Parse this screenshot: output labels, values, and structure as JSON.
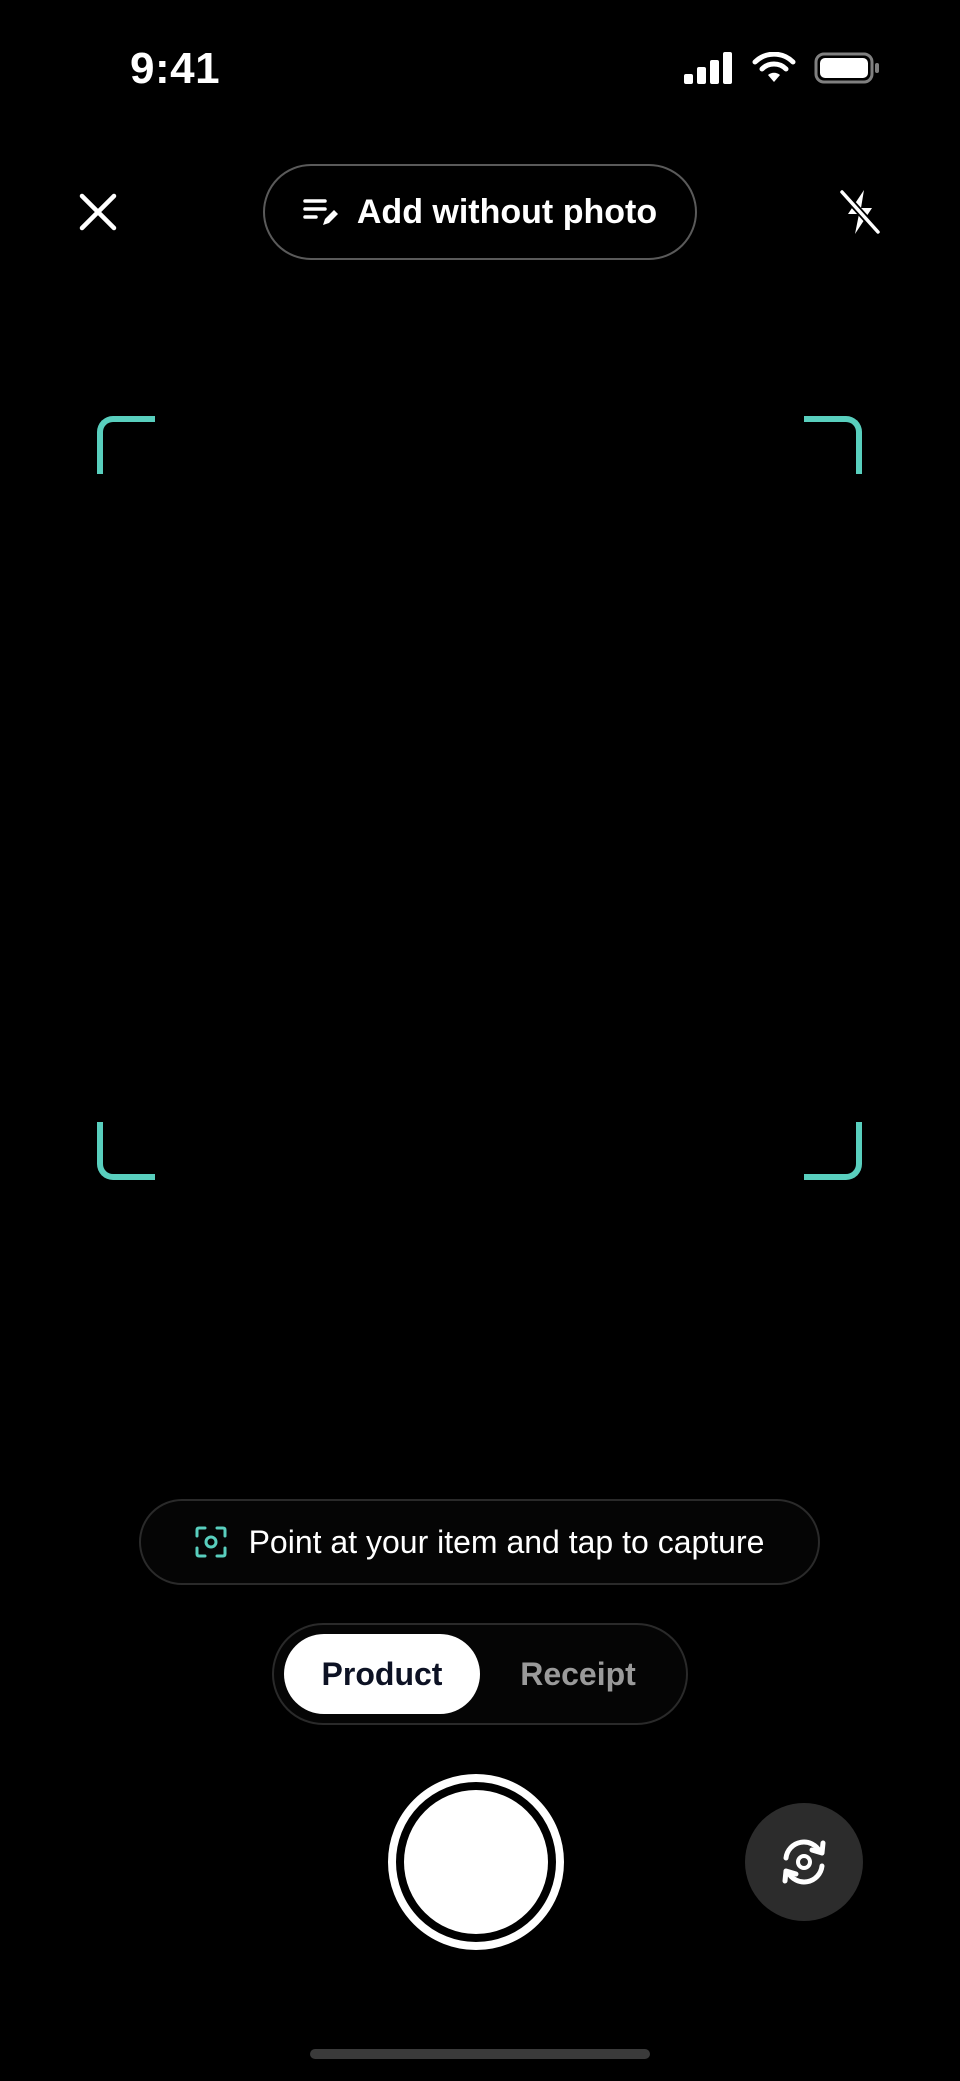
{
  "status_bar": {
    "time": "9:41",
    "icons": [
      "cellular-signal-icon",
      "wifi-icon",
      "battery-icon"
    ]
  },
  "top_bar": {
    "close_icon": "close-icon",
    "add_without_photo": {
      "icon": "edit-list-icon",
      "label": "Add without photo"
    },
    "flash_icon": "flash-off-icon"
  },
  "frame": {
    "accent_color": "#59cfbe"
  },
  "hint": {
    "icon": "focus-scan-icon",
    "text": "Point at your item and tap to capture"
  },
  "mode_toggle": {
    "options": [
      {
        "label": "Product",
        "selected": true
      },
      {
        "label": "Receipt",
        "selected": false
      }
    ]
  },
  "controls": {
    "shutter": "shutter-button",
    "flip_icon": "camera-flip-icon"
  }
}
